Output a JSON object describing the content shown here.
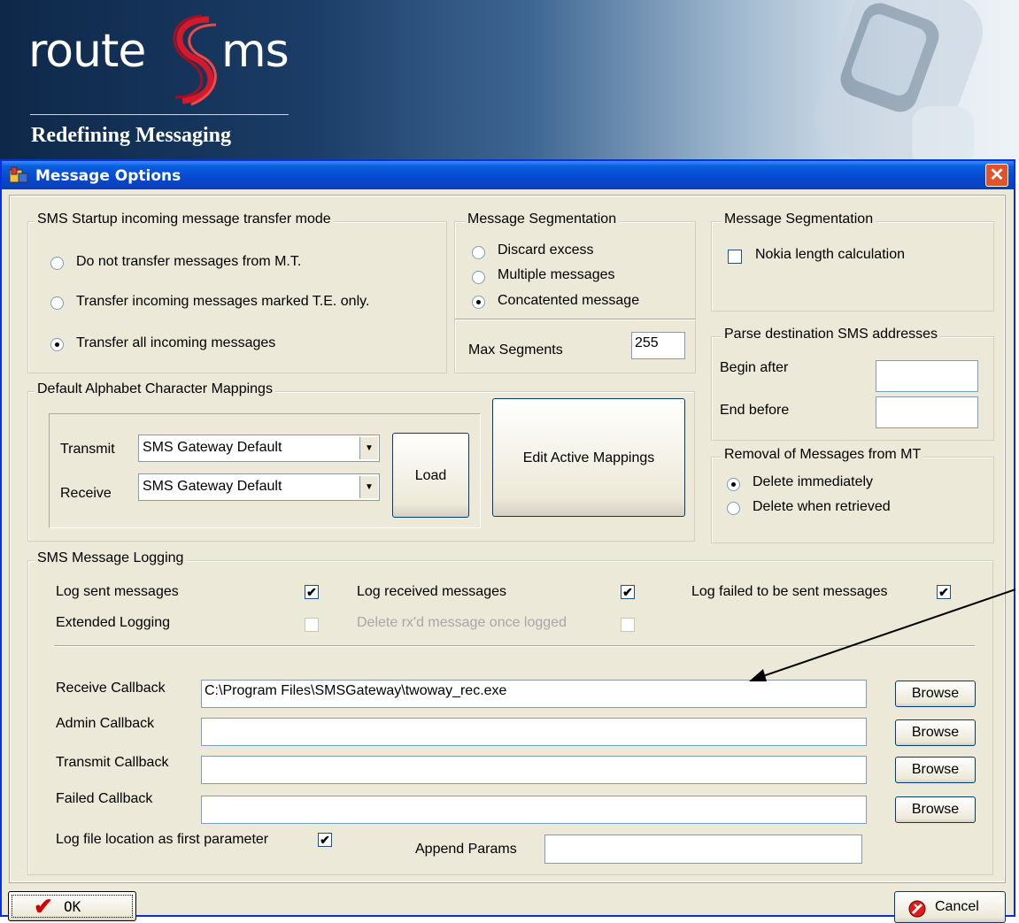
{
  "banner": {
    "logo_route": "route",
    "logo_ms": "ms",
    "tagline": "Redefining Messaging"
  },
  "window": {
    "title": "Message Options",
    "close_icon": "close-icon"
  },
  "startup": {
    "legend": "SMS Startup incoming message transfer mode",
    "options": [
      "Do not transfer messages from M.T.",
      "Transfer incoming messages marked T.E. only.",
      "Transfer all incoming messages"
    ],
    "selected": 2
  },
  "segmentation": {
    "legend": "Message Segmentation",
    "options": [
      "Discard excess",
      "Multiple messages",
      "Concatented message"
    ],
    "selected": 2,
    "max_label": "Max Segments",
    "max_value": "255"
  },
  "nokia": {
    "legend": "Message Segmentation",
    "label": "Nokia length calculation",
    "checked": false
  },
  "parse": {
    "legend": "Parse destination SMS addresses",
    "begin_label": "Begin after",
    "begin_value": "",
    "end_label": "End before",
    "end_value": ""
  },
  "alphabet": {
    "legend": "Default Alphabet Character Mappings",
    "transmit_label": "Transmit",
    "transmit_value": "SMS Gateway Default",
    "receive_label": "Receive",
    "receive_value": "SMS Gateway Default",
    "load_button": "Load",
    "edit_button": "Edit Active Mappings"
  },
  "removal": {
    "legend": "Removal of Messages from MT",
    "options": [
      "Delete immediately",
      "Delete when retrieved"
    ],
    "selected": 0
  },
  "logging": {
    "legend": "SMS Message Logging",
    "log_sent": "Log sent messages",
    "log_received": "Log received messages",
    "log_failed": "Log failed to be sent  messages",
    "extended": "Extended Logging",
    "delete_rx": "Delete rx'd message once logged",
    "receive_cb_label": "Receive Callback",
    "receive_cb_value": "C:\\Program Files\\SMSGateway\\twoway_rec.exe",
    "admin_cb_label": "Admin Callback",
    "admin_cb_value": "",
    "transmit_cb_label": "Transmit Callback",
    "transmit_cb_value": "",
    "failed_cb_label": "Failed Callback",
    "failed_cb_value": "",
    "browse_label": "Browse",
    "logfile_label": "Log file location as first parameter",
    "append_label": "Append Params",
    "append_value": ""
  },
  "footer": {
    "ok_label": "OK",
    "cancel_label": "Cancel"
  },
  "check_mark": "✔"
}
